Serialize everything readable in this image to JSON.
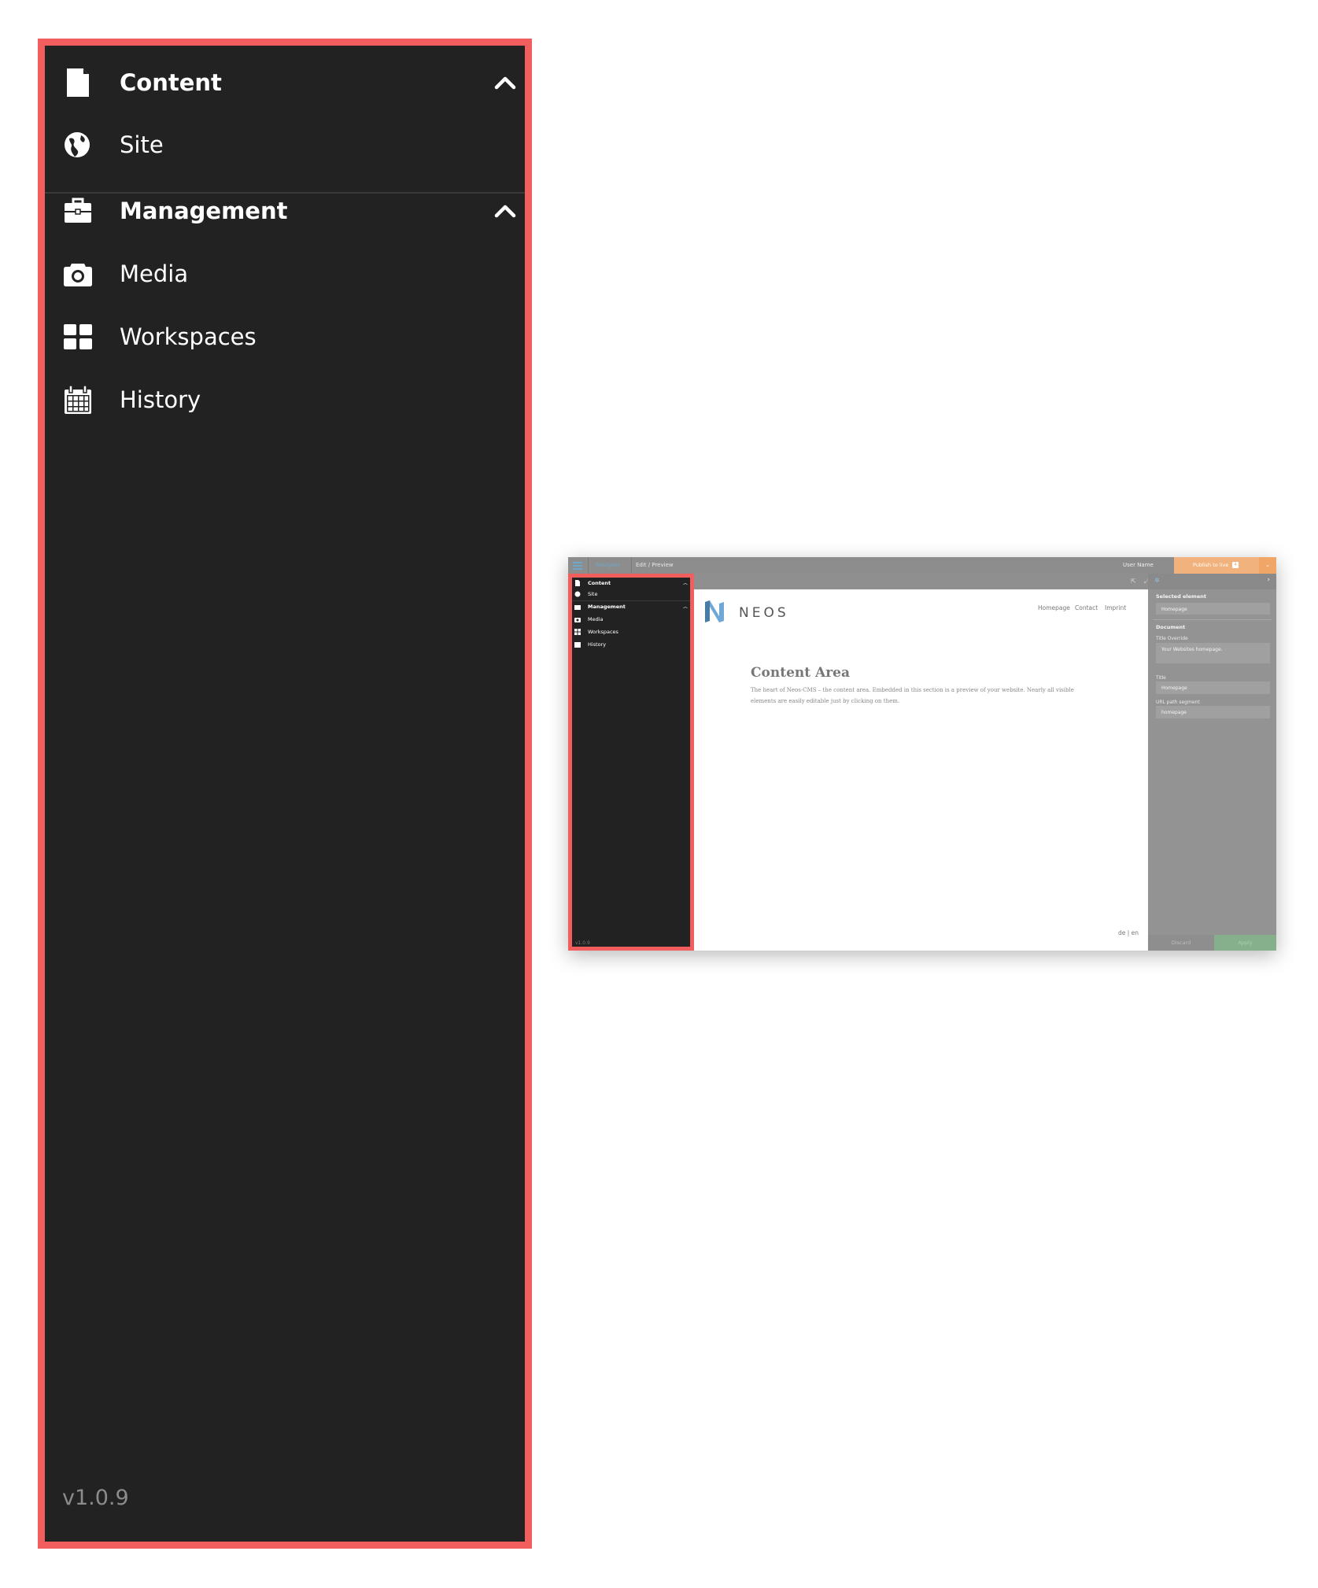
{
  "zoom_menu": {
    "sections": [
      {
        "label": "Content",
        "icon": "file-icon",
        "items": [
          {
            "label": "Site",
            "icon": "globe-icon"
          }
        ]
      },
      {
        "label": "Management",
        "icon": "briefcase-icon",
        "items": [
          {
            "label": "Media",
            "icon": "camera-icon"
          },
          {
            "label": "Workspaces",
            "icon": "th-large-icon"
          },
          {
            "label": "History",
            "icon": "calendar-icon"
          }
        ]
      }
    ],
    "version": "v1.0.9"
  },
  "topbar": {
    "navigate_label": "Navigate",
    "edit_preview_label": "Edit / Preview",
    "user_label": "User Name",
    "publish_label": "Publish to live",
    "publish_count": "4"
  },
  "mini_menu": {
    "content_label": "Content",
    "site_label": "Site",
    "management_label": "Management",
    "media_label": "Media",
    "workspaces_label": "Workspaces",
    "history_label": "History",
    "version": "v1.0.9"
  },
  "content_area": {
    "logo_text": "NEOS",
    "nav": [
      "Homepage",
      "Contact",
      "Imprint"
    ],
    "title": "Content Area",
    "text": "The heart of Neos-CMS – the content area. Embedded in this section is a preview of your website. Nearly all visible elements are easily editable just by clicking on them.",
    "languages": "de | en"
  },
  "inspector": {
    "selected_element_label": "Selected element",
    "selected_element_value": "Homepage",
    "document_label": "Document",
    "title_override_label": "Title Override",
    "title_override_value": "Your Websites homepage.",
    "title_label": "Title",
    "title_value": "Homepage",
    "url_path_label": "URL path segment",
    "url_path_value": "homepage",
    "discard_label": "Discard",
    "apply_label": "Apply"
  },
  "colors": {
    "highlight": "#f25d5d",
    "menu_background": "#222222",
    "publish": "#f2b27d",
    "accent": "#6ea8c8"
  }
}
